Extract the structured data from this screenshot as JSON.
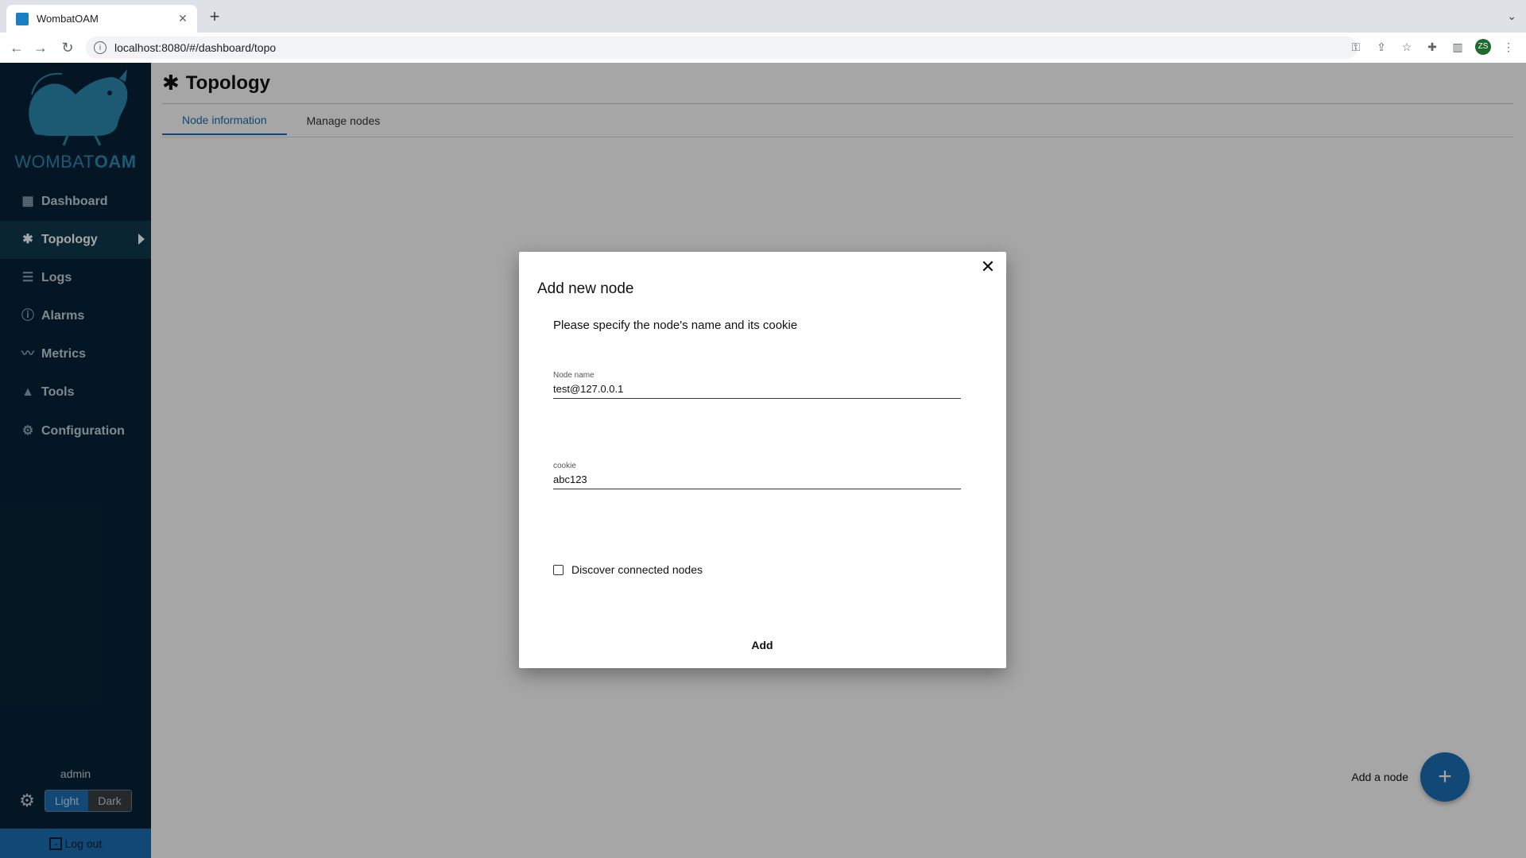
{
  "browser": {
    "tab_title": "WombatOAM",
    "url": "localhost:8080/#/dashboard/topo",
    "profile_initials": "ZS"
  },
  "sidebar": {
    "logo_wombat": "WOMBAT",
    "logo_oam": "OAM",
    "items": [
      {
        "label": "Dashboard",
        "icon": "dashboard-icon"
      },
      {
        "label": "Topology",
        "icon": "topology-icon"
      },
      {
        "label": "Logs",
        "icon": "logs-icon"
      },
      {
        "label": "Alarms",
        "icon": "alarm-icon"
      },
      {
        "label": "Metrics",
        "icon": "metrics-icon"
      },
      {
        "label": "Tools",
        "icon": "tools-icon"
      },
      {
        "label": "Configuration",
        "icon": "configuration-icon"
      }
    ],
    "user": "admin",
    "theme_light": "Light",
    "theme_dark": "Dark",
    "logout": "Log out"
  },
  "main": {
    "title": "Topology",
    "tabs": [
      "Node information",
      "Manage nodes"
    ],
    "fab_label": "Add a node",
    "fab_symbol": "+"
  },
  "dialog": {
    "title": "Add new node",
    "description": "Please specify the node's name and its cookie",
    "node_name_label": "Node name",
    "node_name_value": "test@127.0.0.1",
    "cookie_label": "cookie",
    "cookie_value": "abc123",
    "checkbox_label": "Discover connected nodes",
    "add_button": "Add",
    "close_symbol": "✕"
  },
  "colors": {
    "sidebar_bg": "#072336",
    "accent": "#1b6fb4"
  }
}
